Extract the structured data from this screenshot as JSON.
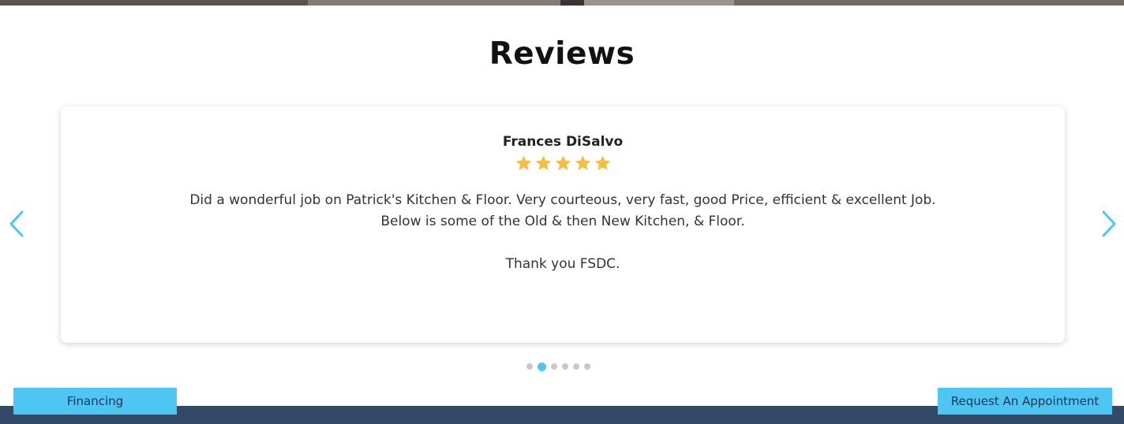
{
  "reviews_section": {
    "title": "Reviews"
  },
  "carousel": {
    "prev_icon": "chevron-left-icon",
    "next_icon": "chevron-right-icon",
    "total_slides": 6,
    "active_slide": 2
  },
  "review": {
    "name": "Frances DiSalvo",
    "rating": 5,
    "rating_max": 5,
    "text_line_1": "Did a wonderful job on Patrick's Kitchen & Floor. Very courteous, very fast, good Price, efficient & excellent Job.",
    "text_line_2": "Below is some of the Old & then New Kitchen, & Floor.",
    "text_line_3": "Thank you FSDC."
  },
  "buttons": {
    "financing": "Financing",
    "appointment": "Request An Appointment"
  },
  "colors": {
    "accent": "#4dc6f4",
    "star": "#f5bd41",
    "footer": "#324a66",
    "dot_inactive": "#c8c8c8"
  }
}
